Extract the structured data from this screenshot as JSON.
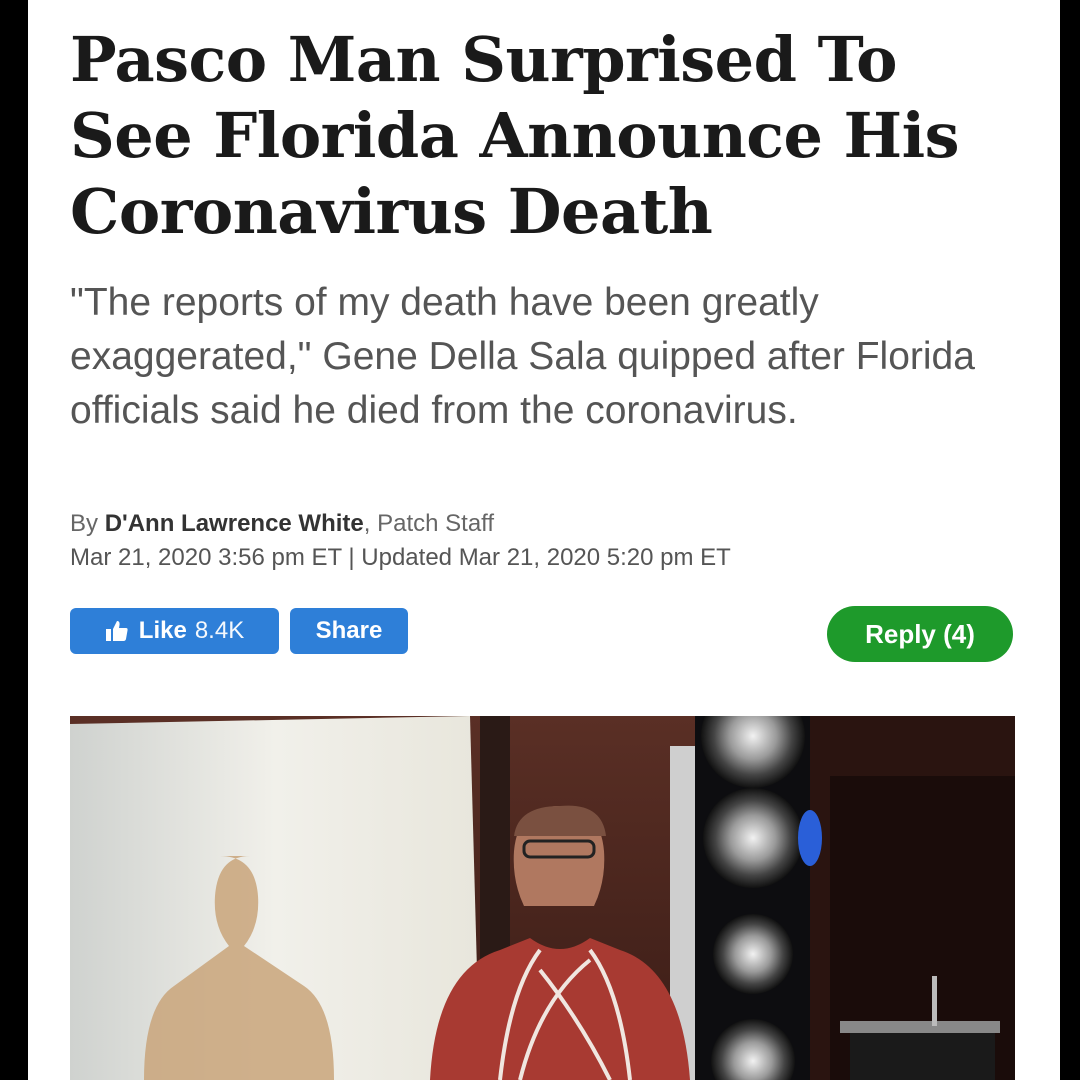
{
  "article": {
    "headline": "Pasco Man Surprised To See Florida Announce His Coronavirus Death",
    "dek": "\"The reports of my death have been greatly exaggerated,\" Gene Della Sala quipped after Florida officials said he died from the coronavirus.",
    "byline_prefix": "By",
    "author": "D'Ann Lawrence White",
    "author_role": ", Patch Staff",
    "dateline": "Mar 21, 2020 3:56 pm ET | Updated Mar 21, 2020 5:20 pm ET"
  },
  "actions": {
    "like_label": "Like",
    "like_count": "8.4K",
    "share_label": "Share",
    "reply_label": "Reply (4)"
  },
  "icons": {
    "like": "thumbs-up-icon"
  },
  "colors": {
    "facebook_blue": "#2e7fd8",
    "reply_green": "#1e9a2b"
  }
}
